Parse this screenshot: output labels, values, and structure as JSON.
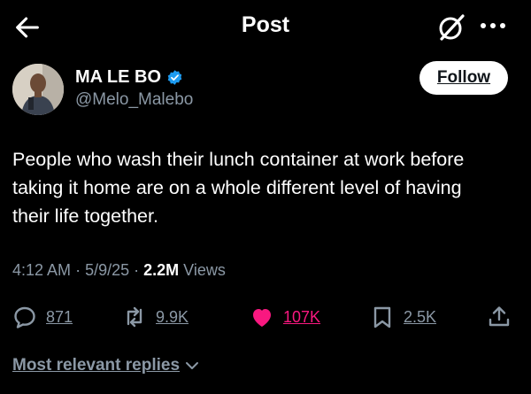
{
  "header": {
    "title": "Post"
  },
  "author": {
    "name": "MA LE BO",
    "handle": "@Melo_Malebo",
    "follow_label": "Follow",
    "verified_color": "#1d9bf0"
  },
  "tweet": {
    "lines": [
      "People who wash their lunch container at work before",
      "taking it home are on a whole different level of having",
      "their life together."
    ]
  },
  "meta": {
    "time": "4:12 AM",
    "date": "5/9/25",
    "views_count": "2.2M",
    "views_label": "Views"
  },
  "actions": {
    "replies": "871",
    "reposts": "9.9K",
    "likes": "107K",
    "bookmarks": "2.5K"
  },
  "replies_sort": {
    "label": "Most relevant replies"
  },
  "colors": {
    "background": "#000000",
    "like_active": "#f91880",
    "muted": "#8b98a5"
  }
}
